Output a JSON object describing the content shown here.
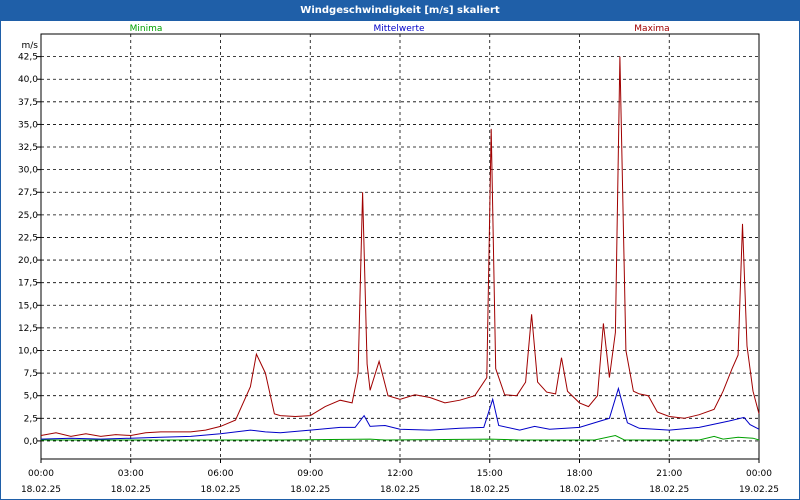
{
  "title": "Windgeschwindigkeit [m/s] skaliert",
  "colors": {
    "minima": "#00a000",
    "mittelwerte": "#0000c8",
    "maxima": "#a00000",
    "titlebar": "#1f5fa8"
  },
  "chart_data": {
    "type": "line",
    "title": "Windgeschwindigkeit [m/s] skaliert",
    "ylabel": "m/s",
    "ylim": [
      -2,
      45
    ],
    "yticks": [
      "0,0",
      "2,5",
      "5,0",
      "7,5",
      "10,0",
      "12,5",
      "15,0",
      "17,5",
      "20,0",
      "22,5",
      "25,0",
      "27,5",
      "30,0",
      "32,5",
      "35,0",
      "37,5",
      "40,0",
      "42,5"
    ],
    "xticks": [
      {
        "time": "00:00",
        "date": "18.02.25"
      },
      {
        "time": "03:00",
        "date": "18.02.25"
      },
      {
        "time": "06:00",
        "date": "18.02.25"
      },
      {
        "time": "09:00",
        "date": "18.02.25"
      },
      {
        "time": "12:00",
        "date": "18.02.25"
      },
      {
        "time": "15:00",
        "date": "18.02.25"
      },
      {
        "time": "18:00",
        "date": "18.02.25"
      },
      {
        "time": "21:00",
        "date": "18.02.25"
      },
      {
        "time": "00:00",
        "date": "19.02.25"
      }
    ],
    "xlim_hours": [
      0,
      24
    ],
    "grid": true,
    "legend_position": "top",
    "series": [
      {
        "name": "Minima",
        "color": "#00a000",
        "points": [
          [
            0,
            0.1
          ],
          [
            4,
            0.1
          ],
          [
            8,
            0.1
          ],
          [
            11,
            0.2
          ],
          [
            11.5,
            0.1
          ],
          [
            15,
            0.2
          ],
          [
            16,
            0.1
          ],
          [
            18.5,
            0.1
          ],
          [
            19.2,
            0.6
          ],
          [
            19.5,
            0.1
          ],
          [
            22,
            0.1
          ],
          [
            22.5,
            0.5
          ],
          [
            22.8,
            0.2
          ],
          [
            23.3,
            0.4
          ],
          [
            23.8,
            0.3
          ],
          [
            24,
            0.1
          ]
        ]
      },
      {
        "name": "Mittelwerte",
        "color": "#0000c8",
        "points": [
          [
            0,
            0.2
          ],
          [
            1,
            0.3
          ],
          [
            2,
            0.2
          ],
          [
            3,
            0.3
          ],
          [
            4,
            0.4
          ],
          [
            5,
            0.5
          ],
          [
            6,
            0.8
          ],
          [
            7,
            1.2
          ],
          [
            7.5,
            1.0
          ],
          [
            8,
            0.9
          ],
          [
            9,
            1.2
          ],
          [
            10,
            1.5
          ],
          [
            10.5,
            1.5
          ],
          [
            10.8,
            2.8
          ],
          [
            11,
            1.6
          ],
          [
            11.5,
            1.7
          ],
          [
            12,
            1.3
          ],
          [
            13,
            1.2
          ],
          [
            14,
            1.4
          ],
          [
            14.8,
            1.5
          ],
          [
            15.1,
            4.6
          ],
          [
            15.3,
            1.7
          ],
          [
            16,
            1.2
          ],
          [
            16.5,
            1.6
          ],
          [
            17,
            1.3
          ],
          [
            18,
            1.5
          ],
          [
            18.7,
            2.2
          ],
          [
            19,
            2.5
          ],
          [
            19.3,
            5.8
          ],
          [
            19.6,
            2.0
          ],
          [
            20,
            1.4
          ],
          [
            21,
            1.2
          ],
          [
            22,
            1.5
          ],
          [
            23,
            2.2
          ],
          [
            23.5,
            2.6
          ],
          [
            23.7,
            1.8
          ],
          [
            24,
            1.3
          ]
        ]
      },
      {
        "name": "Maxima",
        "color": "#a00000",
        "points": [
          [
            0,
            0.6
          ],
          [
            0.5,
            0.9
          ],
          [
            1,
            0.5
          ],
          [
            1.5,
            0.8
          ],
          [
            2,
            0.5
          ],
          [
            2.5,
            0.7
          ],
          [
            3,
            0.6
          ],
          [
            3.5,
            0.9
          ],
          [
            4,
            1.0
          ],
          [
            5,
            1.0
          ],
          [
            5.5,
            1.2
          ],
          [
            6,
            1.6
          ],
          [
            6.5,
            2.3
          ],
          [
            7,
            6.0
          ],
          [
            7.2,
            9.6
          ],
          [
            7.5,
            7.5
          ],
          [
            7.8,
            3.0
          ],
          [
            8,
            2.8
          ],
          [
            8.5,
            2.7
          ],
          [
            9,
            2.8
          ],
          [
            9.5,
            3.8
          ],
          [
            10,
            4.5
          ],
          [
            10.4,
            4.2
          ],
          [
            10.6,
            7.5
          ],
          [
            10.75,
            27.5
          ],
          [
            10.9,
            8.5
          ],
          [
            11,
            5.6
          ],
          [
            11.3,
            8.8
          ],
          [
            11.6,
            5.0
          ],
          [
            12,
            4.6
          ],
          [
            12.5,
            5.1
          ],
          [
            13,
            4.8
          ],
          [
            13.5,
            4.2
          ],
          [
            14,
            4.5
          ],
          [
            14.5,
            5.0
          ],
          [
            14.9,
            7.0
          ],
          [
            15.05,
            34.5
          ],
          [
            15.2,
            8.0
          ],
          [
            15.5,
            5.1
          ],
          [
            15.9,
            5.0
          ],
          [
            16.2,
            6.5
          ],
          [
            16.4,
            14.0
          ],
          [
            16.6,
            6.5
          ],
          [
            16.9,
            5.4
          ],
          [
            17.2,
            5.2
          ],
          [
            17.4,
            9.2
          ],
          [
            17.6,
            5.5
          ],
          [
            18,
            4.2
          ],
          [
            18.3,
            3.8
          ],
          [
            18.6,
            5.0
          ],
          [
            18.8,
            13.0
          ],
          [
            19.0,
            7.0
          ],
          [
            19.2,
            12.0
          ],
          [
            19.35,
            42.5
          ],
          [
            19.55,
            10.0
          ],
          [
            19.8,
            5.5
          ],
          [
            20.0,
            5.2
          ],
          [
            20.3,
            5.0
          ],
          [
            20.6,
            3.2
          ],
          [
            21.0,
            2.7
          ],
          [
            21.5,
            2.5
          ],
          [
            22.0,
            2.9
          ],
          [
            22.5,
            3.5
          ],
          [
            22.8,
            5.5
          ],
          [
            23.1,
            8.0
          ],
          [
            23.3,
            9.5
          ],
          [
            23.45,
            24.0
          ],
          [
            23.6,
            10.5
          ],
          [
            23.8,
            5.5
          ],
          [
            24,
            3.0
          ]
        ]
      }
    ]
  }
}
